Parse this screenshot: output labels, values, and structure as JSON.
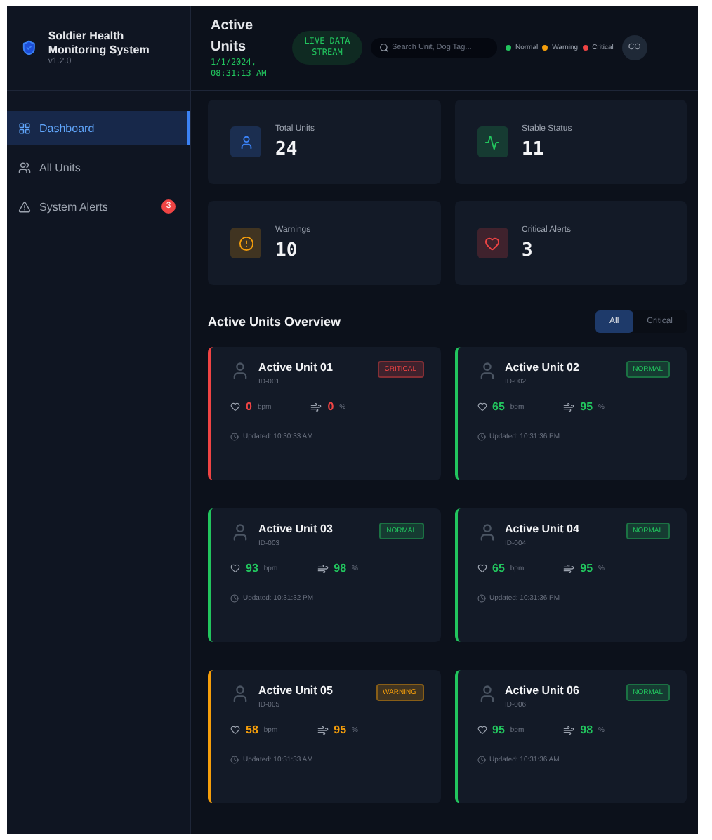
{
  "brand": {
    "title": "Soldier Health Monitoring System",
    "version": "v1.2.0"
  },
  "sidebar": {
    "items": [
      {
        "label": "Dashboard",
        "kind": "grid",
        "selected": true
      },
      {
        "label": "All Units",
        "kind": "users",
        "selected": false
      },
      {
        "label": "System Alerts",
        "kind": "alert",
        "selected": false,
        "badge": "3"
      }
    ]
  },
  "header": {
    "title": "Active Units",
    "datetime": "1/1/2024, 08:31:13 AM",
    "live": "LIVE DATA STREAM",
    "search": {
      "placeholder": "Search Unit, Dog Tag..."
    },
    "legend": [
      {
        "label": "Normal",
        "color": "#22c55e"
      },
      {
        "label": "Warning",
        "color": "#f59e0b"
      },
      {
        "label": "Critical",
        "color": "#ef4444"
      }
    ],
    "avatar": "CO"
  },
  "stats": [
    {
      "label": "Total Units",
      "value": "24",
      "kind": "total"
    },
    {
      "label": "Stable Status",
      "value": "11",
      "kind": "stable"
    },
    {
      "label": "Warnings",
      "value": "10",
      "kind": "warning"
    },
    {
      "label": "Critical Alerts",
      "value": "3",
      "kind": "critical"
    }
  ],
  "overview": {
    "title": "Active Units Overview",
    "filters": [
      {
        "label": "All",
        "selected": true
      },
      {
        "label": "Critical",
        "selected": false
      }
    ]
  },
  "units": [
    {
      "name": "Active Unit 01",
      "id": "ID-001",
      "status": "CRITICAL",
      "kind": "critical",
      "heart": "0",
      "heart_unit": "bpm",
      "spo2": "0",
      "spo2_unit": "%",
      "updated": "Updated: 10:30:33 AM"
    },
    {
      "name": "Active Unit 02",
      "id": "ID-002",
      "status": "NORMAL",
      "kind": "normal",
      "heart": "65",
      "heart_unit": "bpm",
      "spo2": "95",
      "spo2_unit": "%",
      "updated": "Updated: 10:31:36 PM"
    },
    {
      "name": "Active Unit 03",
      "id": "ID-003",
      "status": "NORMAL",
      "kind": "normal",
      "heart": "93",
      "heart_unit": "bpm",
      "spo2": "98",
      "spo2_unit": "%",
      "updated": "Updated: 10:31:32 PM"
    },
    {
      "name": "Active Unit 04",
      "id": "ID-004",
      "status": "NORMAL",
      "kind": "normal",
      "heart": "65",
      "heart_unit": "bpm",
      "spo2": "95",
      "spo2_unit": "%",
      "updated": "Updated: 10:31:36 PM"
    },
    {
      "name": "Active Unit 05",
      "id": "ID-005",
      "status": "WARNING",
      "kind": "warning",
      "heart": "58",
      "heart_unit": "bpm",
      "spo2": "95",
      "spo2_unit": "%",
      "updated": "Updated: 10:31:33 AM"
    },
    {
      "name": "Active Unit 06",
      "id": "ID-006",
      "status": "NORMAL",
      "kind": "normal",
      "heart": "95",
      "heart_unit": "bpm",
      "spo2": "98",
      "spo2_unit": "%",
      "updated": "Updated: 10:31:36 AM"
    }
  ]
}
